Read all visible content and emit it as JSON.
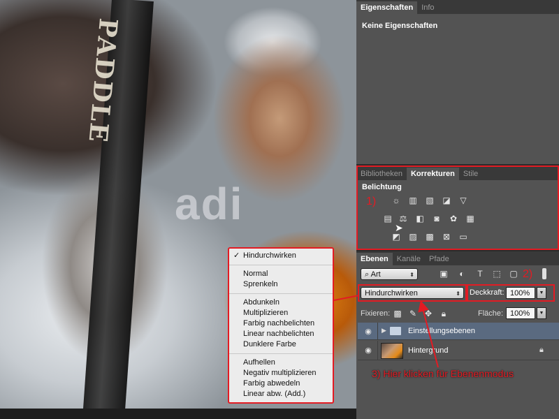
{
  "properties_panel": {
    "tabs": [
      "Eigenschaften",
      "Info"
    ],
    "message": "Keine Eigenschaften"
  },
  "adjustments_panel": {
    "tabs": [
      "Bibliotheken",
      "Korrekturen",
      "Stile"
    ],
    "title": "Belichtung",
    "annotation": "1)"
  },
  "layers_panel": {
    "tabs": [
      "Ebenen",
      "Kanäle",
      "Pfade"
    ],
    "filter_label": "Art",
    "blend_mode": "Hindurchwirken",
    "opacity_label": "Deckkraft:",
    "opacity_value": "100%",
    "lock_label": "Fixieren:",
    "fill_label": "Fläche:",
    "fill_value": "100%",
    "annotation_2": "2)",
    "layers": [
      {
        "name": "Einstellungsebenen",
        "type": "group"
      },
      {
        "name": "Hintergrund",
        "type": "image"
      }
    ]
  },
  "blend_menu": {
    "selected": "Hindurchwirken",
    "groups": [
      [
        "Normal",
        "Sprenkeln"
      ],
      [
        "Abdunkeln",
        "Multiplizieren",
        "Farbig nachbelichten",
        "Linear nachbelichten",
        "Dunklere Farbe"
      ],
      [
        "Aufhellen",
        "Negativ multiplizieren",
        "Farbig abwedeln",
        "Linear abw. (Add.)"
      ]
    ]
  },
  "annotation_3": "3) Hier klicken für Ebenenmodus",
  "canvas": {
    "paddle_text": "PADDLE",
    "background_text": "adi"
  },
  "colors": {
    "annotation_red": "#e31b23",
    "panel_bg": "#535353",
    "tab_bar": "#393939",
    "selected_layer": "#5a6a80"
  }
}
